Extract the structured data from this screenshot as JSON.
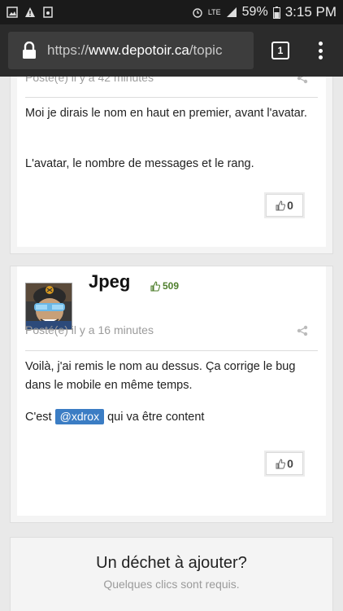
{
  "status": {
    "network": "LTE",
    "battery": "59%",
    "time": "3:15 PM"
  },
  "browser": {
    "url_scheme": "https://",
    "url_host": "www.depotoir.ca",
    "url_path": "/topic",
    "tab_count": "1"
  },
  "posts": [
    {
      "meta": "Posté(e) il y a 42 minutes",
      "paragraphs": [
        "Moi je dirais le nom en haut en premier, avant l'avatar.",
        "L'avatar, le nombre de messages et le rang."
      ],
      "votes": "0"
    },
    {
      "author": "Jpeg",
      "reputation": "509",
      "meta": "Posté(e) il y a 16 minutes",
      "paragraph1": "Voilà, j'ai remis le nom au dessus. Ça corrige le bug dans le mobile en même temps.",
      "paragraph2_before": "C'est ",
      "mention": "@xdrox",
      "paragraph2_after": " qui va être content",
      "votes": "0"
    }
  ],
  "footer": {
    "title": "Un déchet à ajouter?",
    "subtitle": "Quelques clics sont requis."
  },
  "colors": {
    "reputation": "#4f7f2d",
    "mention": "#3b7dc4",
    "browser_bar": "#2b2b2b"
  },
  "icons": [
    "gallery-icon",
    "warning-icon",
    "notification-icon",
    "alarm-icon",
    "signal-icon",
    "battery-icon",
    "lock-icon",
    "share-icon",
    "thumbs-up-icon"
  ]
}
